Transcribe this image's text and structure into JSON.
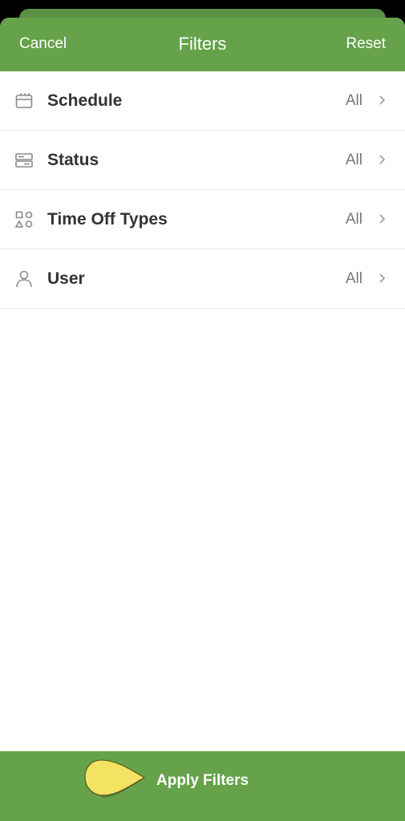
{
  "header": {
    "cancel_label": "Cancel",
    "title": "Filters",
    "reset_label": "Reset"
  },
  "filters": [
    {
      "label": "Schedule",
      "value": "All",
      "icon": "calendar-icon"
    },
    {
      "label": "Status",
      "value": "All",
      "icon": "status-icon"
    },
    {
      "label": "Time Off Types",
      "value": "All",
      "icon": "shapes-icon"
    },
    {
      "label": "User",
      "value": "All",
      "icon": "user-icon"
    }
  ],
  "footer": {
    "apply_label": "Apply Filters"
  },
  "colors": {
    "brand_green": "#66a24a",
    "pointer_yellow": "#f7e463"
  }
}
